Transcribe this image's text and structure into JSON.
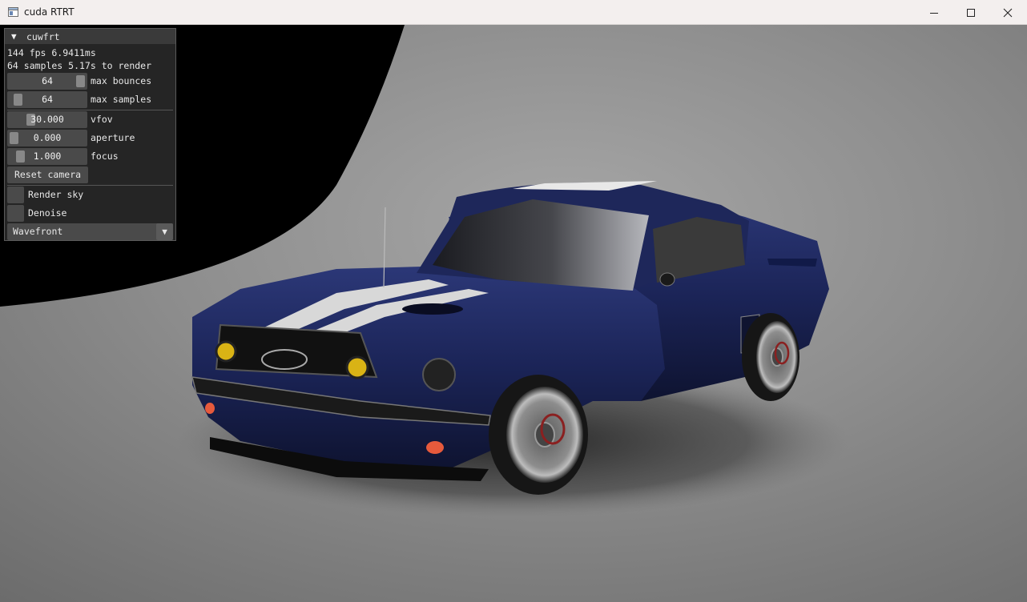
{
  "window": {
    "title": "cuda RTRT"
  },
  "panel": {
    "title": "cuwfrt",
    "collapse_icon": "triangle-down",
    "fps_line": "144 fps 6.9411ms",
    "samples_line": "64 samples 5.17s to render",
    "sliders": [
      {
        "value": "64",
        "label": "max bounces",
        "fill": 0.94
      },
      {
        "value": "64",
        "label": "max samples",
        "fill": 0.06
      }
    ],
    "camera_sliders": [
      {
        "value": "30.000",
        "label": "vfov",
        "fill": 0.27
      },
      {
        "value": "0.000",
        "label": "aperture",
        "fill": 0.0
      },
      {
        "value": "1.000",
        "label": "focus",
        "fill": 0.1
      }
    ],
    "reset_camera_label": "Reset camera",
    "checkboxes": [
      {
        "label": "Render sky",
        "checked": false
      },
      {
        "label": "Denoise",
        "checked": false
      }
    ],
    "render_mode": "Wavefront"
  },
  "colors": {
    "car_body": "#1b2457",
    "panel_bg": "#282828",
    "floor": "#8a8a8a"
  }
}
